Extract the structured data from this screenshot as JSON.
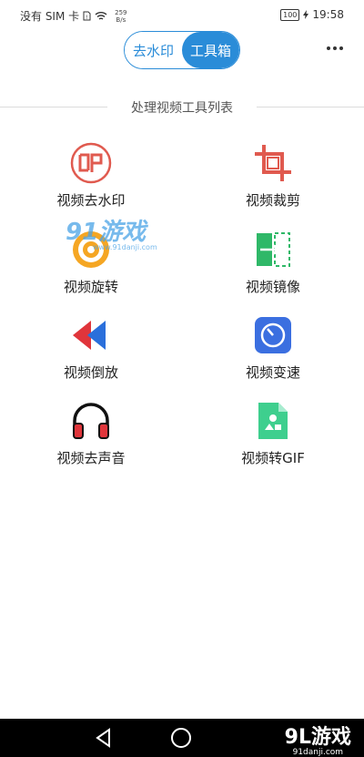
{
  "status_bar": {
    "carrier": "没有 SIM 卡",
    "net_speed_value": "259",
    "net_speed_unit": "B/s",
    "battery": "100",
    "time": "19:58"
  },
  "header": {
    "tabs": [
      {
        "label": "去水印",
        "active": false
      },
      {
        "label": "工具箱",
        "active": true
      }
    ],
    "more_icon": "more-dots-icon"
  },
  "section": {
    "title": "处理视频工具列表"
  },
  "tools": [
    {
      "label": "视频去水印",
      "icon": "stamp-yin-icon",
      "color": "#e05a4f"
    },
    {
      "label": "视频裁剪",
      "icon": "crop-icon",
      "color": "#e05a4f"
    },
    {
      "label": "视频旋转",
      "icon": "rotate-icon",
      "color": "#f5a623"
    },
    {
      "label": "视频镜像",
      "icon": "mirror-icon",
      "color": "#2fb868"
    },
    {
      "label": "视频倒放",
      "icon": "rewind-icon",
      "color": "#2a6fdb"
    },
    {
      "label": "视频变速",
      "icon": "speedometer-icon",
      "color": "#3b6fe0"
    },
    {
      "label": "视频去声音",
      "icon": "headphones-icon",
      "color": "#e0353b"
    },
    {
      "label": "视频转GIF",
      "icon": "gif-file-icon",
      "color": "#3ecf8e"
    }
  ],
  "watermark": {
    "text": "91游戏",
    "sub": "www.91danji.com"
  },
  "brand": {
    "text": "9L游戏",
    "sub": "91danji.com"
  },
  "colors": {
    "accent": "#2a8cd8"
  }
}
